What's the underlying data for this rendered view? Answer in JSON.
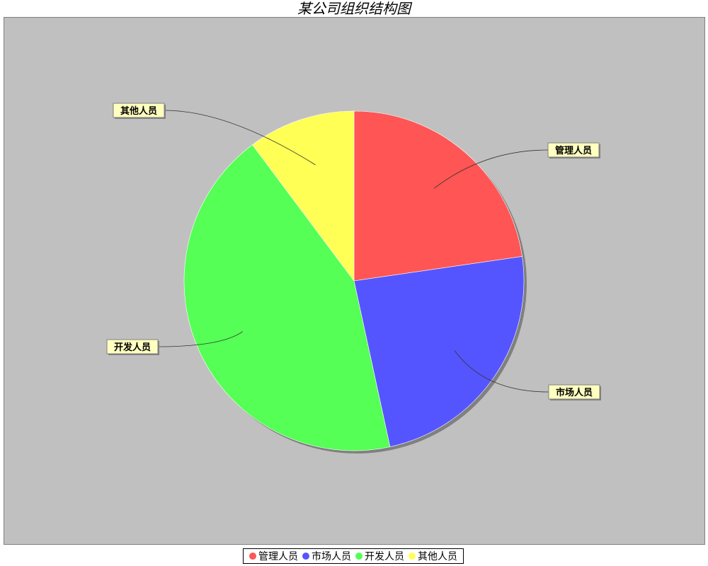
{
  "chart_data": {
    "type": "pie",
    "title": "某公司组织结构图",
    "categories": [
      "管理人员",
      "市场人员",
      "开发人员",
      "其他人员"
    ],
    "values": [
      22.7,
      23.9,
      43.2,
      10.2
    ],
    "colors": [
      "#ff5555",
      "#5555ff",
      "#55ff55",
      "#ffff55"
    ],
    "legend_position": "bottom",
    "plot_background": "#c0c0c0",
    "label_background": "#ffffc0"
  }
}
